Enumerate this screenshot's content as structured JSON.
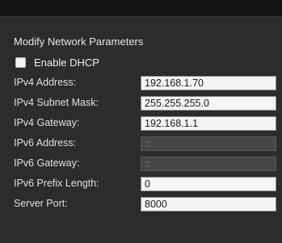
{
  "panel": {
    "title": "Modify Network Parameters",
    "dhcp_label": "Enable DHCP",
    "dhcp_checked": false
  },
  "fields": {
    "ipv4_address": {
      "label": "IPv4 Address:",
      "value": "192.168.1.70"
    },
    "ipv4_subnet_mask": {
      "label": "IPv4 Subnet Mask:",
      "value": "255.255.255.0"
    },
    "ipv4_gateway": {
      "label": "IPv4 Gateway:",
      "value": "192.168.1.1"
    },
    "ipv6_address": {
      "label": "IPv6 Address:",
      "value": "::"
    },
    "ipv6_gateway": {
      "label": "IPv6 Gateway:",
      "value": "::"
    },
    "ipv6_prefix_length": {
      "label": "IPv6 Prefix Length:",
      "value": "0"
    },
    "server_port": {
      "label": "Server Port:",
      "value": "8000"
    }
  }
}
